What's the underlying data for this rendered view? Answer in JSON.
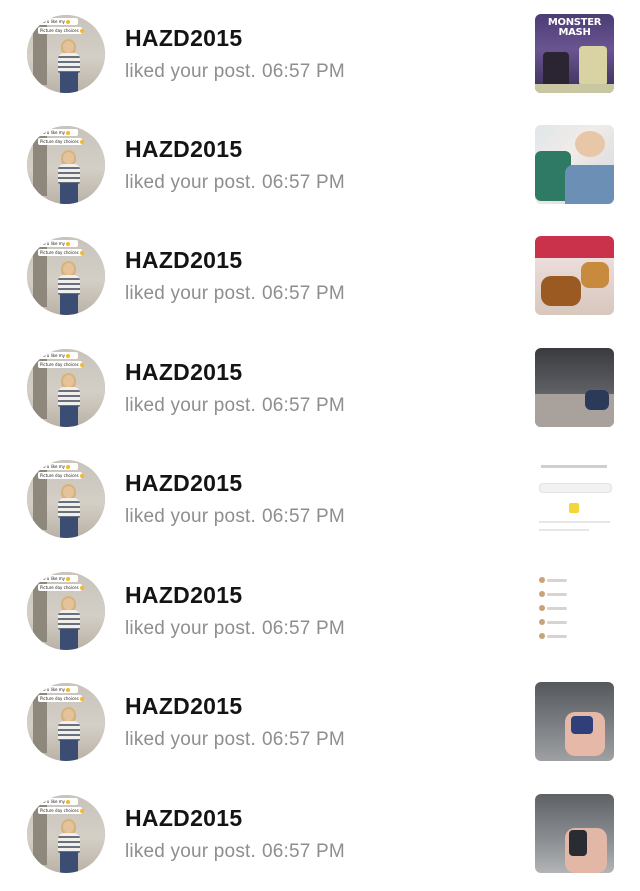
{
  "notifications": [
    {
      "username": "HAZD2015",
      "action": "liked your post.",
      "time": "06:57 PM",
      "thumbnail_icon": "post-thumbnail",
      "thumbnail_text": "MONSTER MASH",
      "avatar_caption1": "Do u like my",
      "avatar_caption2": "Picture day choices"
    },
    {
      "username": "HAZD2015",
      "action": "liked your post.",
      "time": "06:57 PM",
      "thumbnail_icon": "post-thumbnail",
      "thumbnail_text": "",
      "avatar_caption1": "Do u like my",
      "avatar_caption2": "Picture day choices"
    },
    {
      "username": "HAZD2015",
      "action": "liked your post.",
      "time": "06:57 PM",
      "thumbnail_icon": "post-thumbnail",
      "thumbnail_text": "",
      "avatar_caption1": "Do u like my",
      "avatar_caption2": "Picture day choices"
    },
    {
      "username": "HAZD2015",
      "action": "liked your post.",
      "time": "06:57 PM",
      "thumbnail_icon": "post-thumbnail",
      "thumbnail_text": "",
      "avatar_caption1": "Do u like my",
      "avatar_caption2": "Picture day choices"
    },
    {
      "username": "HAZD2015",
      "action": "liked your post.",
      "time": "06:57 PM",
      "thumbnail_icon": "post-thumbnail",
      "thumbnail_text": "",
      "avatar_caption1": "Do u like my",
      "avatar_caption2": "Picture day choices"
    },
    {
      "username": "HAZD2015",
      "action": "liked your post.",
      "time": "06:57 PM",
      "thumbnail_icon": "post-thumbnail",
      "thumbnail_text": "",
      "avatar_caption1": "Do u like my",
      "avatar_caption2": "Picture day choices"
    },
    {
      "username": "HAZD2015",
      "action": "liked your post.",
      "time": "06:57 PM",
      "thumbnail_icon": "post-thumbnail",
      "thumbnail_text": "",
      "avatar_caption1": "Do u like my",
      "avatar_caption2": "Picture day choices"
    },
    {
      "username": "HAZD2015",
      "action": "liked your post.",
      "time": "06:57 PM",
      "thumbnail_icon": "post-thumbnail",
      "thumbnail_text": "",
      "avatar_caption1": "Do u like my",
      "avatar_caption2": "Picture day choices"
    }
  ],
  "colors": {
    "username": "#141414",
    "subtext": "#8e8e8e",
    "background": "#ffffff"
  }
}
